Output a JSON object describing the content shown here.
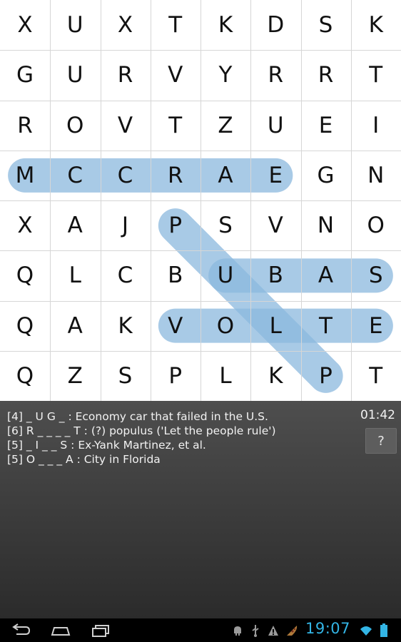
{
  "grid": [
    [
      "X",
      "U",
      "X",
      "T",
      "K",
      "D",
      "S",
      "K"
    ],
    [
      "G",
      "U",
      "R",
      "V",
      "Y",
      "R",
      "R",
      "T"
    ],
    [
      "R",
      "O",
      "V",
      "T",
      "Z",
      "U",
      "E",
      "I"
    ],
    [
      "M",
      "C",
      "C",
      "R",
      "A",
      "E",
      "G",
      "N"
    ],
    [
      "X",
      "A",
      "J",
      "P",
      "S",
      "V",
      "N",
      "O"
    ],
    [
      "Q",
      "L",
      "C",
      "B",
      "U",
      "B",
      "A",
      "S"
    ],
    [
      "Q",
      "A",
      "K",
      "V",
      "O",
      "L",
      "T",
      "E"
    ],
    [
      "Q",
      "Z",
      "S",
      "P",
      "L",
      "K",
      "P",
      "T"
    ]
  ],
  "found_words": [
    {
      "word": "MCCRAE",
      "from": [
        3,
        0
      ],
      "to": [
        3,
        5
      ]
    },
    {
      "word": "PULP",
      "from": [
        4,
        3
      ],
      "to": [
        7,
        6
      ]
    },
    {
      "word": "UBAS",
      "from": [
        5,
        4
      ],
      "to": [
        5,
        7
      ]
    },
    {
      "word": "VOLTE",
      "from": [
        6,
        3
      ],
      "to": [
        6,
        7
      ]
    }
  ],
  "highlight_color": "#8bb8de",
  "clues": [
    "[4] _ U G _ : Economy car that failed in the U.S.",
    "[6] R _ _ _ _ T : (?) populus ('Let the people rule')",
    "[5] _ I _ _ S : Ex-Yank Martinez, et al.",
    "[5] O _ _ _ A : City in Florida"
  ],
  "timer": "01:42",
  "help_label": "?",
  "clock": "19:07",
  "clock_color": "#33b5e5"
}
